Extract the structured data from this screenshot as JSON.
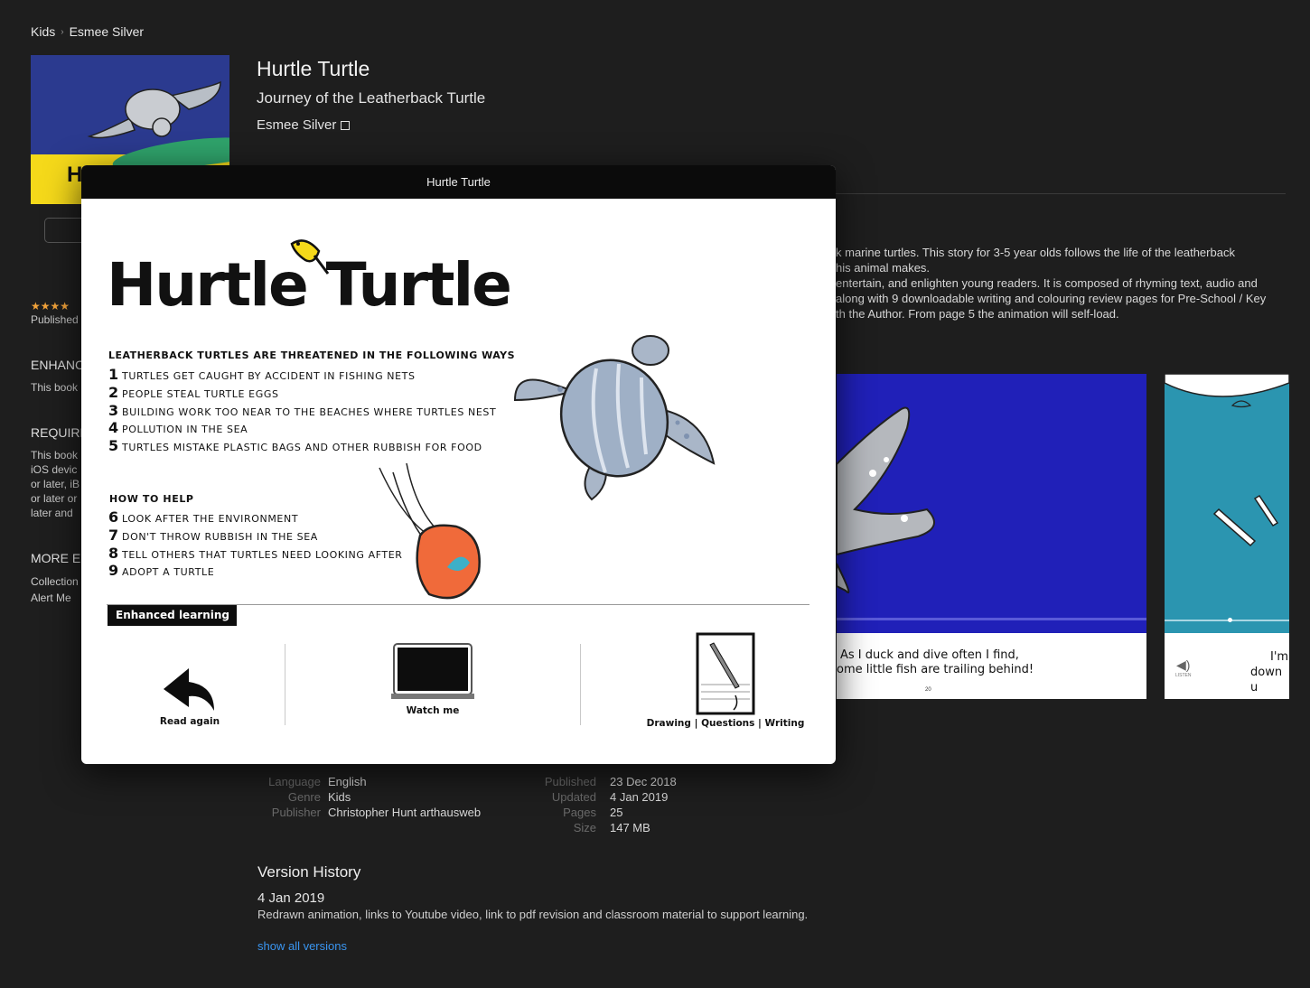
{
  "breadcrumb": [
    "Kids",
    "Esmee Silver"
  ],
  "cover": {
    "letter": "H"
  },
  "book": {
    "title": "Hurtle Turtle",
    "subtitle": "Journey of the Leatherback Turtle",
    "author": "Esmee Silver"
  },
  "left_column": {
    "published_label": "Published",
    "enhanced_heading": "ENHANC",
    "enhanced_text": "This book",
    "requirements_heading": "REQUIRE",
    "requirements_lines": [
      "This book",
      "iOS devic",
      "or later, iB",
      "or later or",
      "later and"
    ],
    "more_heading": "MORE ES",
    "more_links": [
      "Collection",
      "Alert Me"
    ]
  },
  "description_lines": [
    "k marine turtles. This story for 3-5 year olds follows the life of the leatherback",
    "his animal makes.",
    "entertain, and enlighten young readers. It is composed of rhyming text, audio and",
    "along with 9 downloadable writing and colouring review pages for Pre-School / Key",
    "th the Author. From page 5 the animation will self-load."
  ],
  "screenshots": {
    "shot1_caption": [
      "As I duck and dive often I find,",
      "ome little fish are trailing behind!"
    ],
    "shot1_page": "20",
    "shot2_caption": [
      "I'm",
      "down u"
    ],
    "shot2_listen": "LISTEN"
  },
  "info": {
    "left": [
      {
        "label": "Language",
        "value": "English"
      },
      {
        "label": "Genre",
        "value": "Kids"
      },
      {
        "label": "Publisher",
        "value": "Christopher Hunt arthausweb"
      }
    ],
    "right": [
      {
        "label": "Published",
        "value": "23 Dec 2018"
      },
      {
        "label": "Updated",
        "value": "4 Jan 2019"
      },
      {
        "label": "Pages",
        "value": "25"
      },
      {
        "label": "Size",
        "value": "147 MB"
      }
    ]
  },
  "version_history": {
    "title": "Version History",
    "date": "4 Jan 2019",
    "notes": "Redrawn animation, links to Youtube video, link to pdf revision and classroom material to support learning.",
    "link": "show all versions"
  },
  "modal": {
    "window_title": "Hurtle Turtle",
    "page_title": "Hurtle Turtle",
    "threats_heading": "LEATHERBACK TURTLES ARE THREATENED IN THE FOLLOWING WAYS",
    "threats": [
      {
        "n": "1",
        "text": "TURTLES GET CAUGHT BY ACCIDENT IN FISHING NETS"
      },
      {
        "n": "2",
        "text": "PEOPLE STEAL TURTLE EGGS"
      },
      {
        "n": "3",
        "text": "BUILDING WORK TOO NEAR TO THE BEACHES WHERE TURTLES NEST"
      },
      {
        "n": "4",
        "text": "POLLUTION IN THE SEA"
      },
      {
        "n": "5",
        "text": "TURTLES MISTAKE PLASTIC BAGS AND OTHER RUBBISH FOR FOOD"
      }
    ],
    "help_heading": "HOW TO HELP",
    "help": [
      {
        "n": "6",
        "text": "LOOK AFTER THE ENVIRONMENT"
      },
      {
        "n": "7",
        "text": "DON'T THROW RUBBISH IN THE SEA"
      },
      {
        "n": "8",
        "text": "TELL OTHERS THAT TURTLES NEED LOOKING AFTER"
      },
      {
        "n": "9",
        "text": "ADOPT A TURTLE"
      }
    ],
    "enhanced_label": "Enhanced learning",
    "actions": {
      "read_again": "Read again",
      "watch_me": "Watch me",
      "drawing": "Drawing | Questions | Writing"
    }
  },
  "colors": {
    "link": "#3a95f0",
    "stars": "#f2a33a",
    "background": "#1e1e1e",
    "sea": "#2020b8",
    "jelly": "#f06a3a"
  }
}
